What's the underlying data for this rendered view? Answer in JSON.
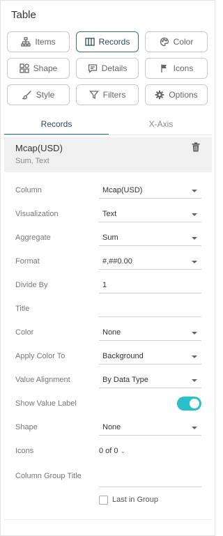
{
  "panel": {
    "title": "Table"
  },
  "buttons": [
    {
      "label": "Items",
      "icon": "hierarchy-icon"
    },
    {
      "label": "Records",
      "icon": "columns-icon",
      "active": true
    },
    {
      "label": "Color",
      "icon": "palette-icon"
    },
    {
      "label": "Shape",
      "icon": "shapes-icon"
    },
    {
      "label": "Details",
      "icon": "speech-bubble-icon"
    },
    {
      "label": "Icons",
      "icon": "flag-icon"
    },
    {
      "label": "Style",
      "icon": "brush-icon"
    },
    {
      "label": "Filters",
      "icon": "filter-icon"
    },
    {
      "label": "Options",
      "icon": "gear-icon"
    }
  ],
  "tabs": [
    {
      "label": "Records",
      "active": true
    },
    {
      "label": "X-Axis",
      "active": false
    }
  ],
  "record": {
    "title": "Mcap(USD)",
    "subtitle": "Sum, Text"
  },
  "form": {
    "column": {
      "label": "Column",
      "value": "Mcap(USD)"
    },
    "visualization": {
      "label": "Visualization",
      "value": "Text"
    },
    "aggregate": {
      "label": "Aggregate",
      "value": "Sum"
    },
    "format": {
      "label": "Format",
      "value": "#,##0.00"
    },
    "divide_by": {
      "label": "Divide By",
      "value": "1"
    },
    "title": {
      "label": "Title",
      "value": ""
    },
    "color": {
      "label": "Color",
      "value": "None"
    },
    "apply_color_to": {
      "label": "Apply Color To",
      "value": "Background"
    },
    "value_alignment": {
      "label": "Value Alignment",
      "value": "By Data Type"
    },
    "show_value_label": {
      "label": "Show Value Label",
      "on": true
    },
    "shape": {
      "label": "Shape",
      "value": "None"
    },
    "icons": {
      "label": "Icons",
      "value": "0 of 0"
    },
    "column_group_title": {
      "label": "Column Group Title",
      "value": ""
    },
    "last_in_group": {
      "label": "Last in Group",
      "checked": false
    }
  },
  "colors": {
    "accent": "#2a6a8a",
    "toggle_on": "#2bbfcb",
    "active_border": "#3e6f87"
  }
}
